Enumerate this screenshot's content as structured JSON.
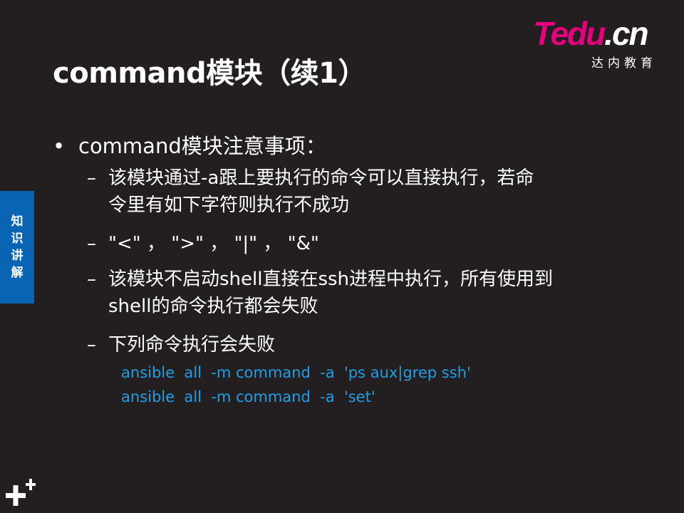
{
  "slide": {
    "title": "command模块（续1）",
    "logo": {
      "brand_main": "Tedu",
      "brand_suffix": ".cn",
      "brand_sub": "达内教育"
    },
    "side_tab": [
      "知",
      "识",
      "讲",
      "解"
    ],
    "bullet": {
      "marker": "•",
      "text": "command模块注意事项："
    },
    "sub_items": [
      {
        "marker": "–",
        "lines": [
          "该模块通过-a跟上要执行的命令可以直接执行，若命",
          "令里有如下字符则执行不成功"
        ]
      },
      {
        "marker": "–",
        "lines": [
          "\"<\" ， \">\" ， \"|\" ， \"&\""
        ]
      },
      {
        "marker": "–",
        "lines": [
          "该模块不启动shell直接在ssh进程中执行，所有使用到",
          "shell的命令执行都会失败"
        ]
      },
      {
        "marker": "–",
        "lines": [
          "下列命令执行会失败"
        ]
      }
    ],
    "code_lines": [
      "ansible  all  -m command  -a  'ps aux|grep ssh'",
      "ansible  all  -m command  -a  'set'"
    ],
    "colors": {
      "background": "#231f20",
      "text": "#ffffff",
      "code": "#1ea0e6",
      "side_tab": "#0a64b4",
      "logo_accent": "#e6007e"
    },
    "icons": {
      "corner": "plus-plus-icon"
    }
  }
}
